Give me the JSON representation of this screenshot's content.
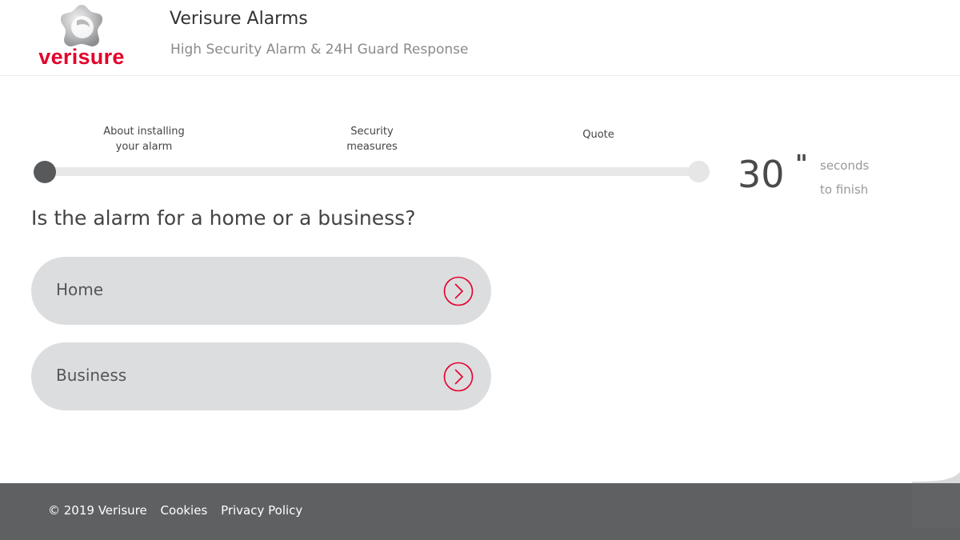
{
  "header": {
    "logo_text": "verisure",
    "title": "Verisure Alarms",
    "subtitle": "High Security Alarm & 24H Guard Response"
  },
  "progress": {
    "steps": [
      {
        "label": "About installing\nyour alarm"
      },
      {
        "label": "Security\nmeasures"
      },
      {
        "label": "Quote"
      }
    ],
    "current_step": 1,
    "fraction_complete": 0.0
  },
  "timer": {
    "value": "30",
    "mark": "\"",
    "unit": "seconds\nto finish"
  },
  "question": {
    "text": "Is the alarm for a home or a business?"
  },
  "options": [
    {
      "label": "Home",
      "icon": "chevron-right-circle-icon"
    },
    {
      "label": "Business",
      "icon": "chevron-right-circle-icon"
    }
  ],
  "footer": {
    "copyright": "© 2019 Verisure",
    "cookies": "Cookies",
    "privacy": "Privacy Policy"
  },
  "colors": {
    "brand_red": "#e4002b",
    "option_bg": "#dcdddf",
    "footer_bg": "#5f6062",
    "track_bg": "#e8e8e8",
    "progress_dot": "#58595b"
  }
}
